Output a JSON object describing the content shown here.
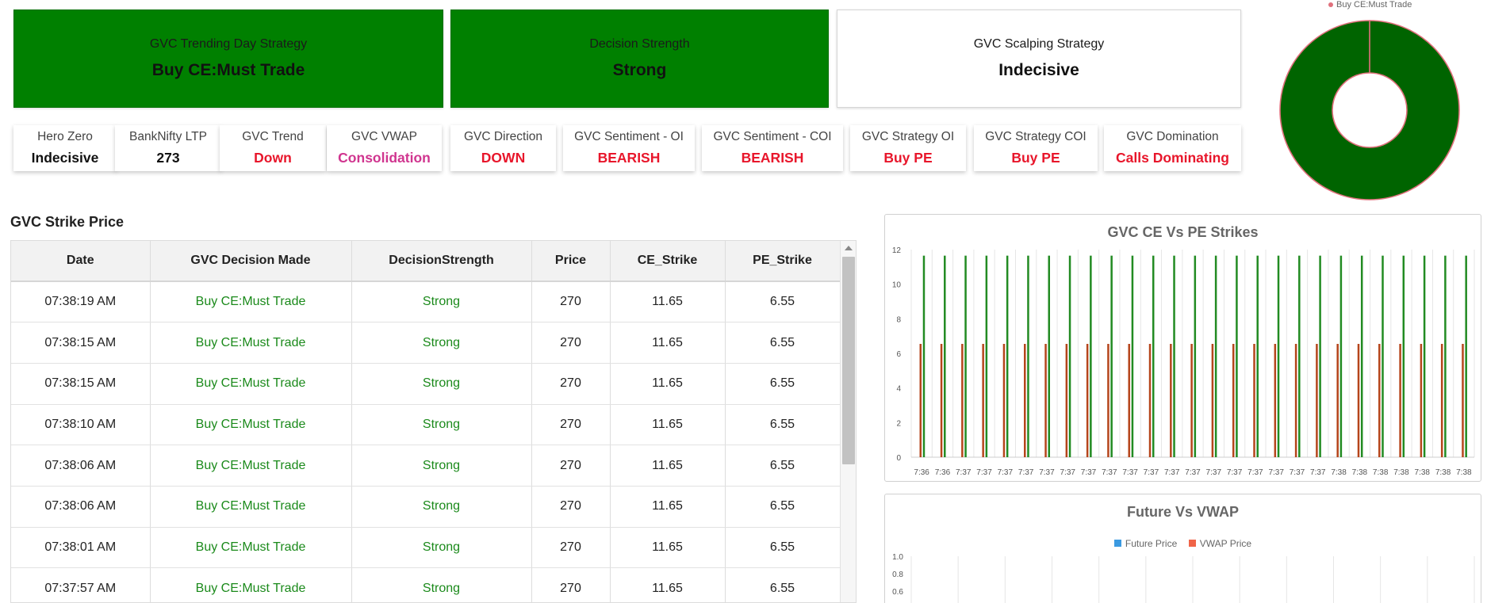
{
  "top_cards": [
    {
      "title": "GVC Trending Day Strategy",
      "value": "Buy CE:Must Trade"
    },
    {
      "title": "Decision Strength",
      "value": "Strong"
    },
    {
      "title": "GVC Scalping Strategy",
      "value": "Indecisive"
    }
  ],
  "indicators": [
    {
      "title": "Hero Zero",
      "value": "Indecisive",
      "color": "#111111"
    },
    {
      "title": "BankNifty LTP",
      "value": "273",
      "color": "#111111"
    },
    {
      "title": "GVC Trend",
      "value": "Down",
      "color": "#e8162b"
    },
    {
      "title": "GVC VWAP",
      "value": "Consolidation",
      "color": "#d0358f"
    },
    {
      "title": "GVC Direction",
      "value": "DOWN",
      "color": "#e8162b"
    },
    {
      "title": "GVC Sentiment - OI",
      "value": "BEARISH",
      "color": "#e8162b"
    },
    {
      "title": "GVC Sentiment - COI",
      "value": "BEARISH",
      "color": "#e8162b"
    },
    {
      "title": "GVC Strategy OI",
      "value": "Buy PE",
      "color": "#e8162b"
    },
    {
      "title": "GVC Strategy COI",
      "value": "Buy PE",
      "color": "#e8162b"
    },
    {
      "title": "GVC Domination",
      "value": "Calls Dominating",
      "color": "#e8162b"
    }
  ],
  "colors": {
    "card_green": "#008000",
    "donut_fill": "#006400",
    "donut_border": "#e0707c",
    "ce_bar": "#228b22",
    "pe_bar": "#b5451b",
    "future": "#3b9ae1",
    "vwap": "#f06448",
    "table_green": "#1b8a1b"
  },
  "donut": {
    "legend": "Buy CE:Must Trade"
  },
  "strike_table": {
    "title": "GVC Strike Price",
    "columns": [
      "Date",
      "GVC Decision Made",
      "DecisionStrength",
      "Price",
      "CE_Strike",
      "PE_Strike"
    ],
    "rows": [
      [
        "07:38:19 AM",
        "Buy CE:Must Trade",
        "Strong",
        "270",
        "11.65",
        "6.55"
      ],
      [
        "07:38:15 AM",
        "Buy CE:Must Trade",
        "Strong",
        "270",
        "11.65",
        "6.55"
      ],
      [
        "07:38:15 AM",
        "Buy CE:Must Trade",
        "Strong",
        "270",
        "11.65",
        "6.55"
      ],
      [
        "07:38:10 AM",
        "Buy CE:Must Trade",
        "Strong",
        "270",
        "11.65",
        "6.55"
      ],
      [
        "07:38:06 AM",
        "Buy CE:Must Trade",
        "Strong",
        "270",
        "11.65",
        "6.55"
      ],
      [
        "07:38:06 AM",
        "Buy CE:Must Trade",
        "Strong",
        "270",
        "11.65",
        "6.55"
      ],
      [
        "07:38:01 AM",
        "Buy CE:Must Trade",
        "Strong",
        "270",
        "11.65",
        "6.55"
      ],
      [
        "07:37:57 AM",
        "Buy CE:Must Trade",
        "Strong",
        "270",
        "11.65",
        "6.55"
      ]
    ]
  },
  "chart_data": [
    {
      "type": "bar",
      "title": "GVC CE Vs PE Strikes",
      "categories": [
        "7:36",
        "7:36",
        "7:37",
        "7:37",
        "7:37",
        "7:37",
        "7:37",
        "7:37",
        "7:37",
        "7:37",
        "7:37",
        "7:37",
        "7:37",
        "7:37",
        "7:37",
        "7:37",
        "7:37",
        "7:37",
        "7:37",
        "7:37",
        "7:38",
        "7:38",
        "7:38",
        "7:38",
        "7:38",
        "7:38",
        "7:38"
      ],
      "series": [
        {
          "values": [
            11.65,
            11.65,
            11.65,
            11.65,
            11.65,
            11.65,
            11.65,
            11.65,
            11.65,
            11.65,
            11.65,
            11.65,
            11.65,
            11.65,
            11.65,
            11.65,
            11.65,
            11.65,
            11.65,
            11.65,
            11.65,
            11.65,
            11.65,
            11.65,
            11.65,
            11.65,
            11.65
          ],
          "color": "#228b22"
        },
        {
          "values": [
            6.55,
            6.55,
            6.55,
            6.55,
            6.55,
            6.55,
            6.55,
            6.55,
            6.55,
            6.55,
            6.55,
            6.55,
            6.55,
            6.55,
            6.55,
            6.55,
            6.55,
            6.55,
            6.55,
            6.55,
            6.55,
            6.55,
            6.55,
            6.55,
            6.55,
            6.55,
            6.55
          ],
          "color": "#b5451b"
        }
      ],
      "ylim": [
        0,
        12
      ],
      "yticks": [
        0,
        2,
        4,
        6,
        8,
        10,
        12
      ],
      "grid": true
    },
    {
      "type": "line",
      "title": "Future Vs VWAP",
      "series": [
        {
          "name": "Future Price",
          "values": [],
          "color": "#3b9ae1"
        },
        {
          "name": "VWAP Price",
          "values": [],
          "color": "#f06448"
        }
      ],
      "ylim": [
        0,
        1.0
      ],
      "yticks_visible": [
        "1.0",
        "0.8",
        "0.6"
      ],
      "legend": "top-center",
      "grid": true
    }
  ]
}
